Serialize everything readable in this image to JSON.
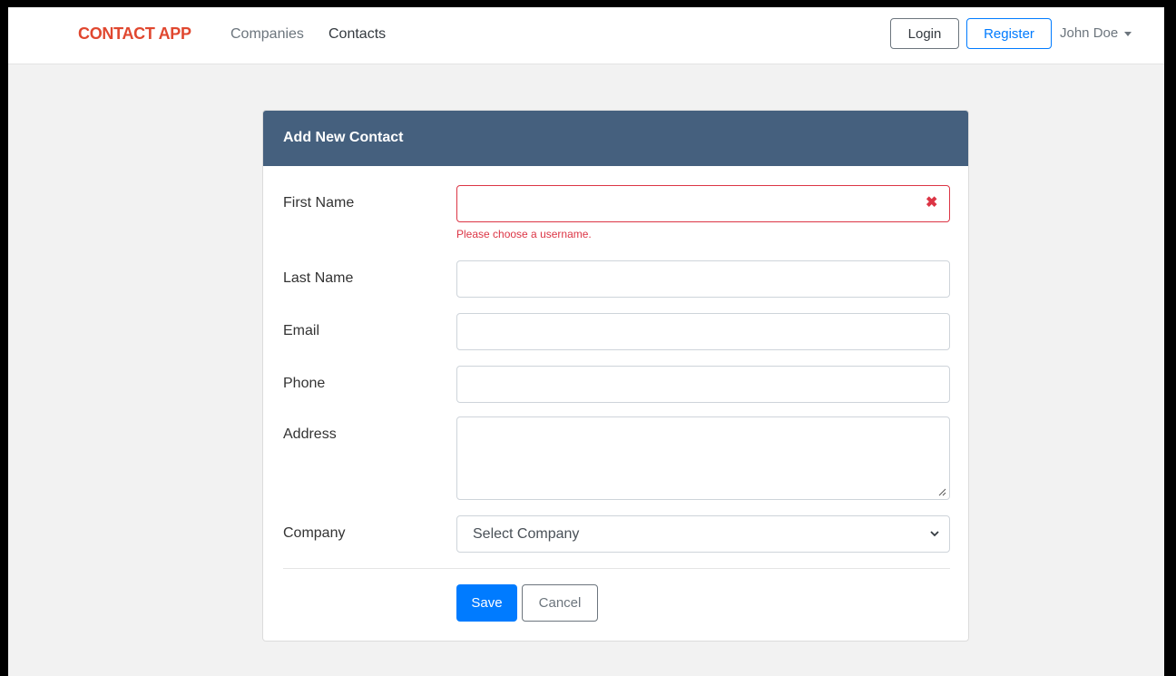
{
  "navbar": {
    "brand": "CONTACT APP",
    "links": [
      {
        "label": "Companies",
        "active": false
      },
      {
        "label": "Contacts",
        "active": true
      }
    ],
    "login_label": "Login",
    "register_label": "Register",
    "user_name": "John Doe"
  },
  "form": {
    "title": "Add New Contact",
    "first_name": {
      "label": "First Name",
      "value": "",
      "error": "Please choose a username."
    },
    "last_name": {
      "label": "Last Name",
      "value": ""
    },
    "email": {
      "label": "Email",
      "value": ""
    },
    "phone": {
      "label": "Phone",
      "value": ""
    },
    "address": {
      "label": "Address",
      "value": ""
    },
    "company": {
      "label": "Company",
      "selected": "Select Company"
    },
    "save_label": "Save",
    "cancel_label": "Cancel"
  },
  "colors": {
    "brand": "#e0472f",
    "header": "#45607e",
    "primary": "#007bff",
    "danger": "#dc3545"
  },
  "icons": [
    "invalid-x-icon",
    "resize-handle-icon",
    "chevron-down-icon",
    "caret-down-icon"
  ]
}
